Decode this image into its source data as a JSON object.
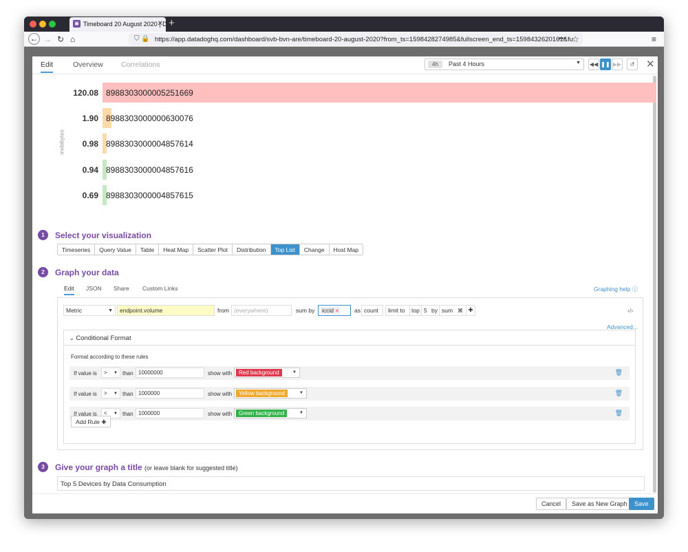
{
  "browser": {
    "tab_title": "Timeboard 20 August 2020 | Da",
    "new_tab": "+",
    "url": "https://app.datadoghq.com/dashboard/svb-bvn-are/timeboard-20-august-2020?from_ts=1598428274985&fullscreen_end_ts=1598432620161&fu",
    "colors": {
      "close": "#fe5f57",
      "minimize": "#febc2e",
      "maximize": "#28c840"
    }
  },
  "modal": {
    "tabs": [
      {
        "label": "Edit",
        "state": "active"
      },
      {
        "label": "Overview",
        "state": "normal"
      },
      {
        "label": "Correlations",
        "state": "disabled"
      }
    ],
    "time": {
      "pill": "4h",
      "label": "Past 4 Hours"
    }
  },
  "toplist": {
    "unit_label": "mebibytes",
    "rows": [
      {
        "value": "120.08",
        "name": "8988303000005251669",
        "fraction": 1.0,
        "color": "#ffbfbe"
      },
      {
        "value": "1.90",
        "name": "8988303000000630076",
        "fraction": 0.016,
        "color": "#ffd9a8"
      },
      {
        "value": "0.98",
        "name": "8988303000004857614",
        "fraction": 0.008,
        "color": "#ffd9a8"
      },
      {
        "value": "0.94",
        "name": "8988303000004857616",
        "fraction": 0.008,
        "color": "#c4e8c0"
      },
      {
        "value": "0.69",
        "name": "8988303000004857615",
        "fraction": 0.006,
        "color": "#c4e8c0"
      }
    ]
  },
  "step1": {
    "number": "1",
    "title": "Select your visualization"
  },
  "visualizations": [
    {
      "label": "Timeseries",
      "active": false
    },
    {
      "label": "Query Value",
      "active": false
    },
    {
      "label": "Table",
      "active": false
    },
    {
      "label": "Heat Map",
      "active": false
    },
    {
      "label": "Scatter Plot",
      "active": false
    },
    {
      "label": "Distribution",
      "active": false
    },
    {
      "label": "Top List",
      "active": true
    },
    {
      "label": "Change",
      "active": false
    },
    {
      "label": "Host Map",
      "active": false
    }
  ],
  "step2": {
    "number": "2",
    "title": "Graph your data"
  },
  "graph_tabs": [
    {
      "label": "Edit",
      "active": true
    },
    {
      "label": "JSON",
      "active": false
    },
    {
      "label": "Share",
      "active": false
    },
    {
      "label": "Custom Links",
      "active": false
    }
  ],
  "graphing_help": "Graphing help",
  "query": {
    "type": "Metric",
    "metric": "endpoint.volume",
    "from_label": "from",
    "from_placeholder": "(everywhere)",
    "sum_by_label": "sum by",
    "sum_by_tag": "iccid",
    "as_label": "as",
    "as_value": "count",
    "limit_label": "limit to",
    "limit_dir": "top",
    "limit_n": "5",
    "by_label": "by",
    "by_value": "sum"
  },
  "advanced": "Advanced...",
  "conditional_format": {
    "title": "Conditional Format",
    "description": "Format according to these rules",
    "rules": [
      {
        "prefix": "If value is",
        "op": ">",
        "than": "than",
        "value": "10000000",
        "show": "show with",
        "palette": "Red background",
        "color": "#e0384c"
      },
      {
        "prefix": "If value is",
        "op": ">",
        "than": "than",
        "value": "1000000",
        "show": "show with",
        "palette": "Yellow background",
        "color": "#f0a92a"
      },
      {
        "prefix": "If value is",
        "op": "<",
        "than": "than",
        "value": "1000000",
        "show": "show with",
        "palette": "Green background",
        "color": "#33b24a"
      }
    ],
    "add_rule": "Add Rule"
  },
  "step3": {
    "number": "3",
    "title": "Give your graph a title",
    "hint": "(or leave blank for suggested title)"
  },
  "graph_title": "Top 5 Devices by Data Consumption",
  "footer": {
    "cancel": "Cancel",
    "save_new": "Save as New Graph",
    "save": "Save"
  }
}
